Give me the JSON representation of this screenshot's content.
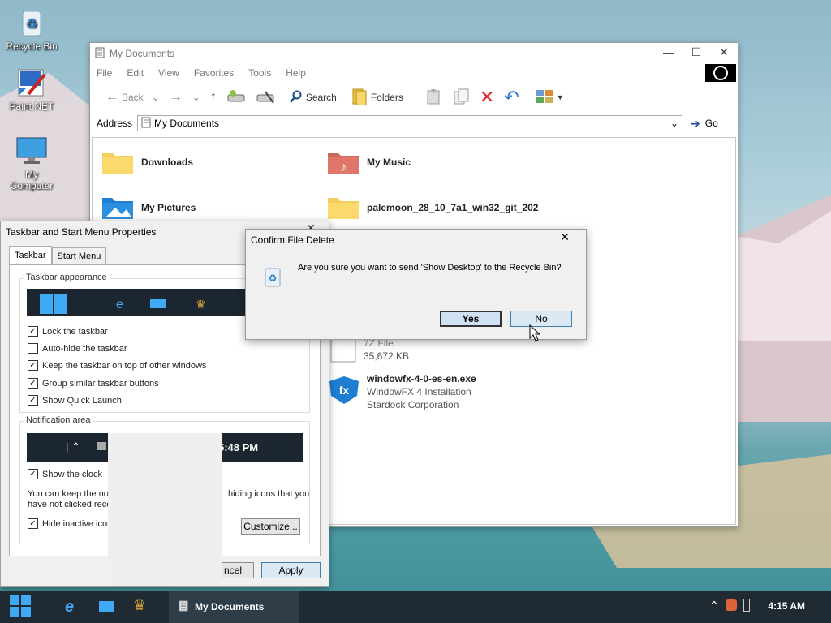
{
  "desktop": {
    "icons": [
      {
        "label": "Recycle Bin"
      },
      {
        "label": "Paint.NET"
      },
      {
        "label": "My Computer"
      }
    ]
  },
  "explorer": {
    "title": "My Documents",
    "menu": [
      "File",
      "Edit",
      "View",
      "Favorites",
      "Tools",
      "Help"
    ],
    "toolbar": {
      "back": "Back",
      "search": "Search",
      "folders": "Folders"
    },
    "address": {
      "label": "Address",
      "value": "My Documents",
      "go": "Go"
    },
    "files": [
      {
        "name": "Downloads"
      },
      {
        "name": "My Music"
      },
      {
        "name": "My Pictures"
      },
      {
        "name": "palemoon_28_10_7a1_win32_git_202"
      },
      {
        "name": "7Z File",
        "detail": "35,672 KB"
      },
      {
        "name": "windowfx-4-0-es-en.exe",
        "line2": "WindowFX 4 Installation",
        "line3": "Stardock Corporation"
      }
    ]
  },
  "props": {
    "title": "Taskbar and Start Menu Properties",
    "tabs": [
      "Taskbar",
      "Start Menu"
    ],
    "appearance_label": "Taskbar appearance",
    "checks": [
      {
        "label": "Lock the taskbar",
        "checked": true
      },
      {
        "label": "Auto-hide the taskbar",
        "checked": false
      },
      {
        "label": "Keep the taskbar on top of other windows",
        "checked": true
      },
      {
        "label": "Group similar taskbar buttons",
        "checked": true
      },
      {
        "label": "Show Quick Launch",
        "checked": true
      }
    ],
    "notification_label": "Notification area",
    "preview_time": "5:48 PM",
    "show_clock": "Show the clock",
    "info_left1": "You can keep the no",
    "info_right1": "hiding icons that you",
    "info_left2": "have not clicked rece",
    "hide_inactive": "Hide inactive icon",
    "customize": "Customize...",
    "cancel": "ncel",
    "apply": "Apply"
  },
  "confirm": {
    "title": "Confirm File Delete",
    "message": "Are you sure you want to send 'Show Desktop' to the Recycle Bin?",
    "yes": "Yes",
    "no": "No"
  },
  "taskbar": {
    "task_label": "My Documents",
    "clock": "4:15 AM"
  }
}
